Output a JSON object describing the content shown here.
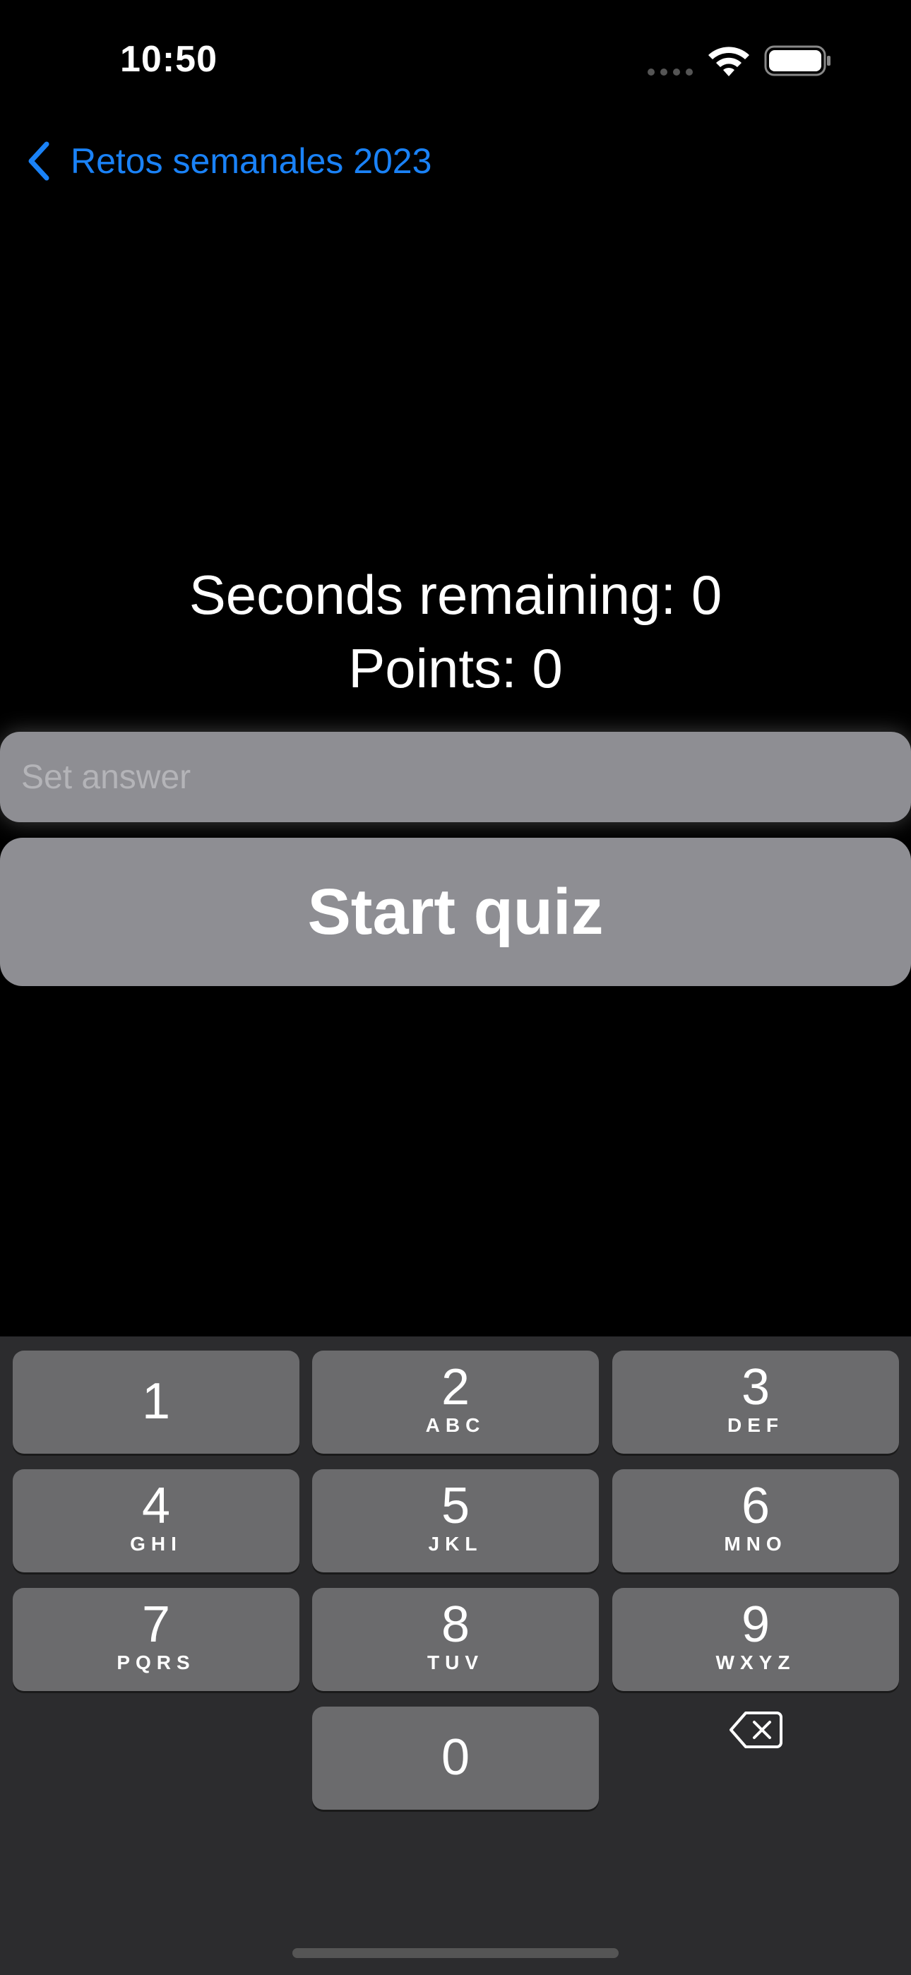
{
  "status_bar": {
    "time": "10:50"
  },
  "nav": {
    "back_label": "Retos semanales 2023"
  },
  "info": {
    "seconds_remaining": "Seconds remaining: 0",
    "points": "Points: 0"
  },
  "answer": {
    "placeholder": "Set answer",
    "value": ""
  },
  "start_button": {
    "label": "Start quiz"
  },
  "keyboard": {
    "keys": [
      {
        "digit": "1",
        "letters": ""
      },
      {
        "digit": "2",
        "letters": "ABC"
      },
      {
        "digit": "3",
        "letters": "DEF"
      },
      {
        "digit": "4",
        "letters": "GHI"
      },
      {
        "digit": "5",
        "letters": "JKL"
      },
      {
        "digit": "6",
        "letters": "MNO"
      },
      {
        "digit": "7",
        "letters": "PQRS"
      },
      {
        "digit": "8",
        "letters": "TUV"
      },
      {
        "digit": "9",
        "letters": "WXYZ"
      },
      {
        "digit": "0",
        "letters": ""
      }
    ],
    "delete_icon": "delete-backspace-icon"
  },
  "colors": {
    "accent": "#1a82f7",
    "background": "#000000",
    "button": "#8e8e93",
    "key": "#6b6b6d",
    "keyboard_bg": "#2c2c2e"
  }
}
